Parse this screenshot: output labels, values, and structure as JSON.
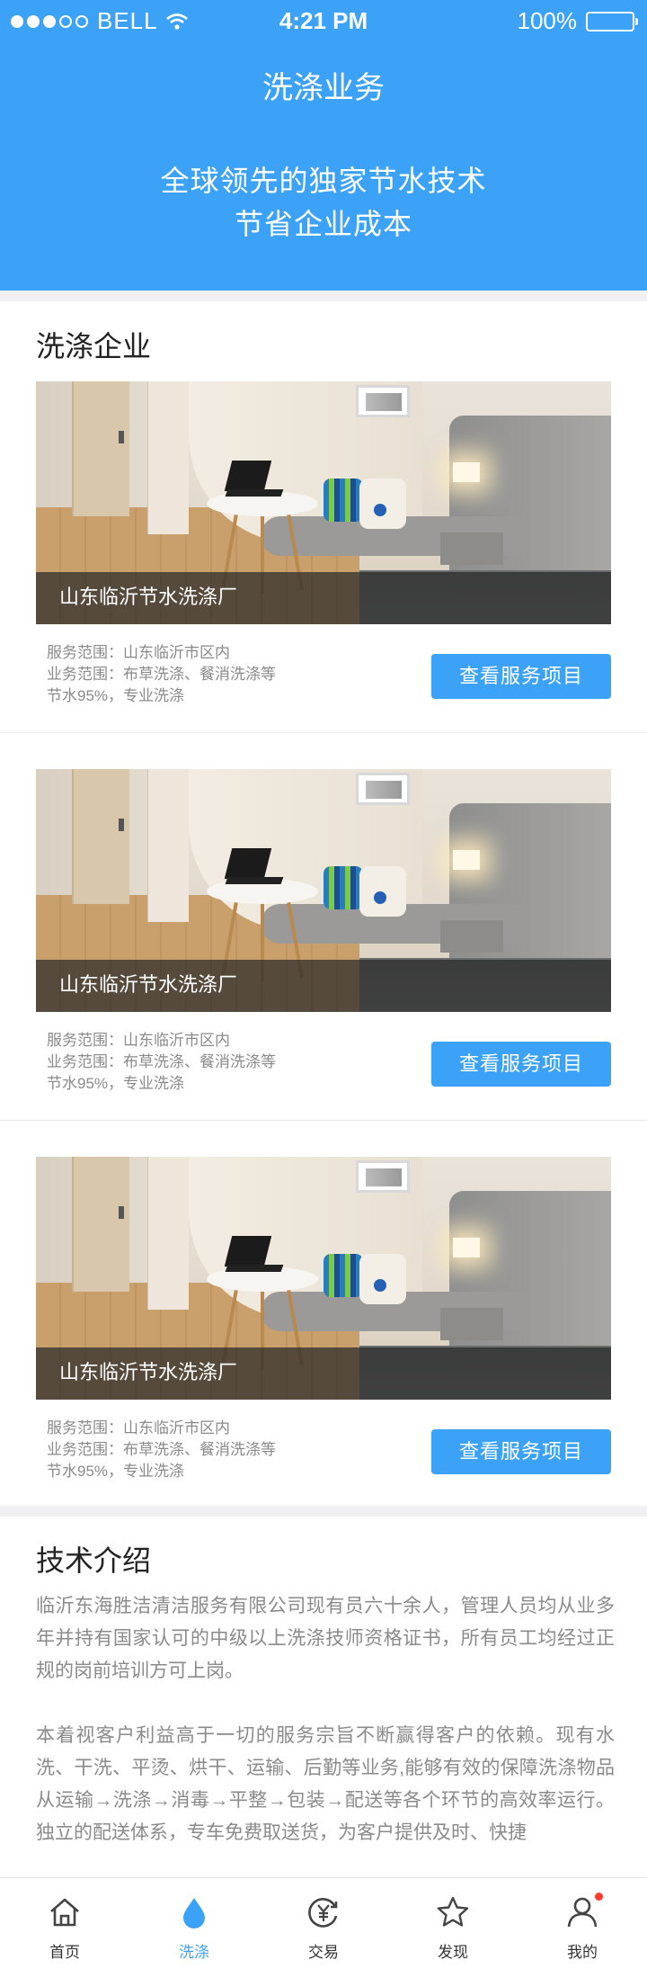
{
  "status_bar": {
    "carrier": "BELL",
    "time": "4:21 PM",
    "battery": "100%"
  },
  "header": {
    "title": "洗涤业务",
    "tagline_1": "全球领先的独家节水技术",
    "tagline_2": "节省企业成本"
  },
  "companies_section": {
    "title": "洗涤企业",
    "cards": [
      {
        "name": "山东临沂节水洗涤厂",
        "scope": "服务范围：山东临沂市区内",
        "business": "业务范围：布草洗涤、餐消洗涤等",
        "feature": "节水95%，专业洗涤",
        "button": "查看服务项目"
      },
      {
        "name": "山东临沂节水洗涤厂",
        "scope": "服务范围：山东临沂市区内",
        "business": "业务范围：布草洗涤、餐消洗涤等",
        "feature": "节水95%，专业洗涤",
        "button": "查看服务项目"
      },
      {
        "name": "山东临沂节水洗涤厂",
        "scope": "服务范围：山东临沂市区内",
        "business": "业务范围：布草洗涤、餐消洗涤等",
        "feature": "节水95%，专业洗涤",
        "button": "查看服务项目"
      }
    ]
  },
  "tech_section": {
    "title": "技术介绍",
    "paragraph_1": "临沂东海胜洁清洁服务有限公司现有员六十余人，管理人员均从业多年并持有国家认可的中级以上洗涤技师资格证书，所有员工均经过正规的岗前培训方可上岗。",
    "paragraph_2": "本着视客户利益高于一切的服务宗旨不断赢得客户的依赖。现有水洗、干洗、平烫、烘干、运输、后勤等业务,能够有效的保障洗涤物品从运输→洗涤→消毒→平整→包装→配送等各个环节的高效率运行。独立的配送体系，专车免费取送货，为客户提供及时、快捷"
  },
  "tabbar": {
    "items": [
      {
        "label": "首页",
        "icon": "home-icon"
      },
      {
        "label": "洗涤",
        "icon": "water-drop-icon",
        "active": true
      },
      {
        "label": "交易",
        "icon": "yuan-exchange-icon"
      },
      {
        "label": "发现",
        "icon": "star-icon"
      },
      {
        "label": "我的",
        "icon": "user-icon",
        "badge": true
      }
    ]
  },
  "colors": {
    "primary": "#3ba2f7",
    "badge": "#ff3b30",
    "text_gray": "#8a8a8a"
  }
}
